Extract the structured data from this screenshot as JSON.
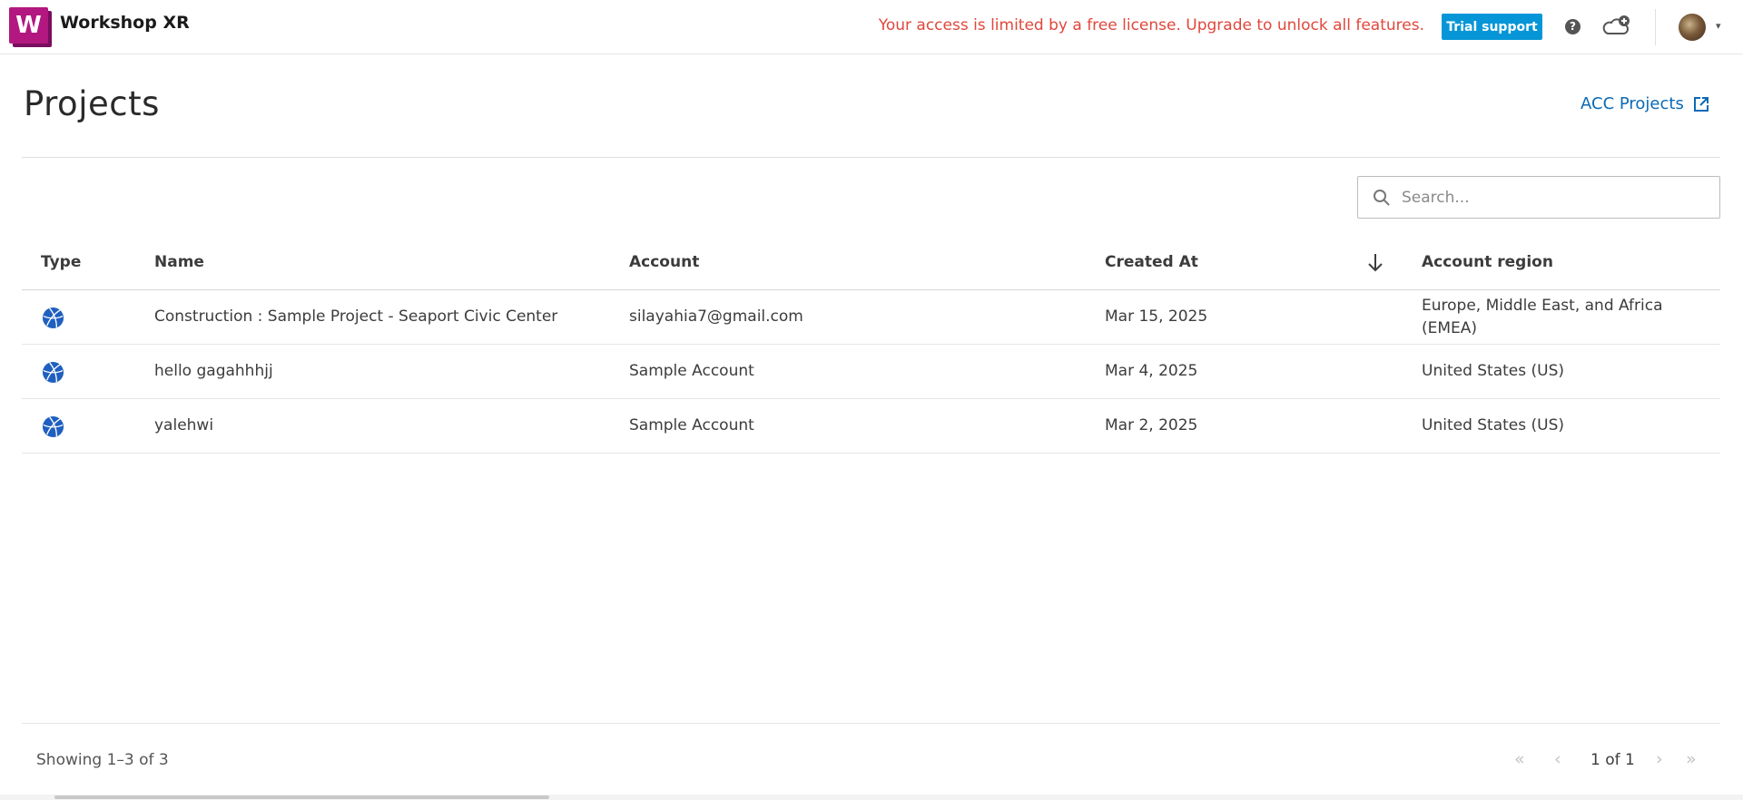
{
  "header": {
    "logo_letter": "W",
    "app_name": "Workshop XR",
    "license_notice": "Your access is limited by a free license. Upgrade to unlock all features.",
    "trial_support_label": "Trial support",
    "help_glyph": "?",
    "avatar_caret": "▾"
  },
  "page": {
    "title": "Projects",
    "acc_link_label": "ACC Projects"
  },
  "search": {
    "placeholder": "Search..."
  },
  "table": {
    "columns": {
      "type": "Type",
      "name": "Name",
      "account": "Account",
      "created_at": "Created At",
      "region": "Account region"
    },
    "sort_direction": "descending",
    "rows": [
      {
        "type_icon": "globe-icon",
        "name": "Construction : Sample Project - Seaport Civic Center",
        "account": "silayahia7@gmail.com",
        "created_at": "Mar 15, 2025",
        "region": "Europe, Middle East, and Africa (EMEA)"
      },
      {
        "type_icon": "globe-icon",
        "name": "hello gagahhhjj",
        "account": "Sample Account",
        "created_at": "Mar 4, 2025",
        "region": "United States (US)"
      },
      {
        "type_icon": "globe-icon",
        "name": "yalehwi",
        "account": "Sample Account",
        "created_at": "Mar 2, 2025",
        "region": "United States (US)"
      }
    ]
  },
  "footer": {
    "showing": "Showing 1–3 of 3",
    "page_indicator": "1 of 1",
    "first_glyph": "«",
    "prev_glyph": "‹",
    "next_glyph": "›",
    "last_glyph": "»"
  },
  "colors": {
    "brand": "#b2187f",
    "notice": "#e0473c",
    "primary_button": "#0696d7",
    "link": "#0a6ab6",
    "type_icon": "#1f5fbf"
  }
}
